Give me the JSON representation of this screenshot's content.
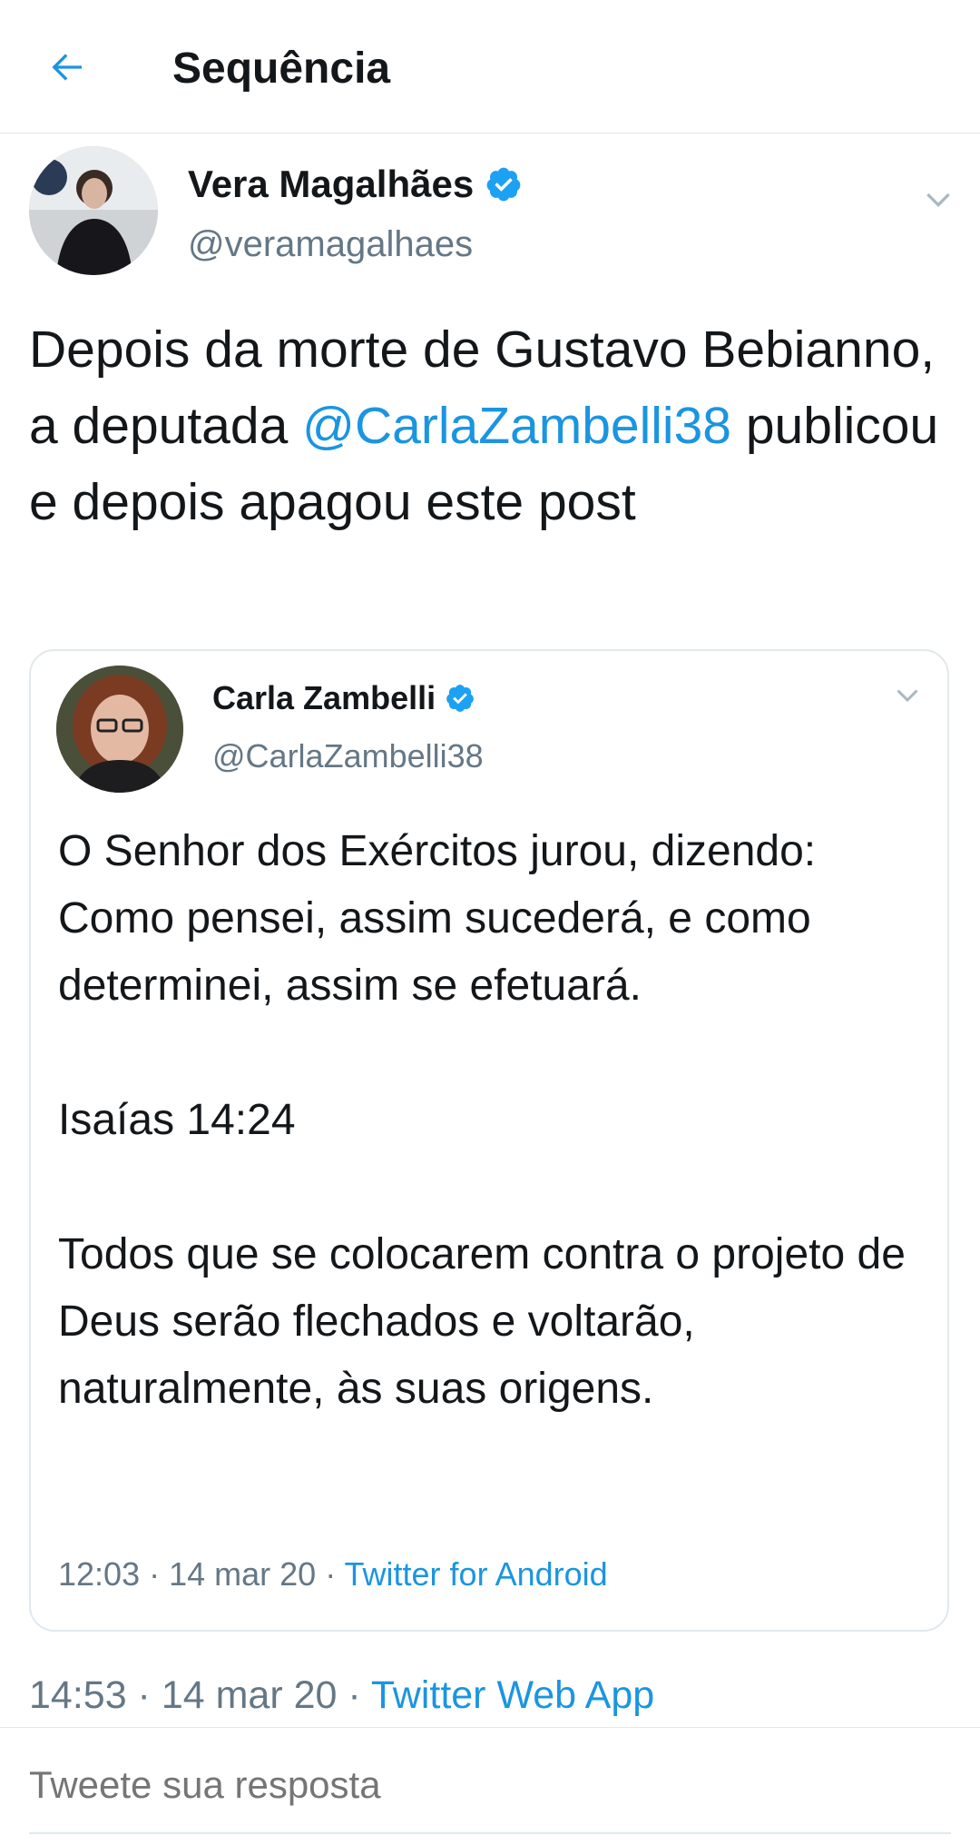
{
  "header": {
    "title": "Sequência",
    "back_icon": "arrow-left-icon"
  },
  "tweet": {
    "author_name": "Vera Magalhães",
    "author_handle": "@veramagalhaes",
    "text_before_mention": "Depois da morte de Gustavo Bebianno, a deputada ",
    "mention": "@CarlaZambelli38",
    "text_after_mention": " publicou e depois apagou este post",
    "time": "14:53",
    "date": "14 mar 20",
    "separator": " · ",
    "source": "Twitter Web App"
  },
  "quoted_tweet": {
    "author_name": "Carla Zambelli",
    "author_handle": "@CarlaZambelli38",
    "paragraphs": [
      "O Senhor dos Exércitos jurou, dizendo: Como pensei, assim sucederá, e como determinei, assim se efetuará.",
      "Isaías 14:24",
      "Todos que se colocarem contra o projeto de Deus serão flechados e voltarão, naturalmente, às suas origens."
    ],
    "time": "12:03",
    "date": "14 mar 20",
    "separator": " · ",
    "source": "Twitter for Android"
  },
  "reply": {
    "placeholder": "Tweete sua resposta"
  },
  "colors": {
    "accent": "#1b95e0",
    "secondary_text": "#657786",
    "border": "#e1e8ed",
    "verified": "#1da1f2"
  }
}
